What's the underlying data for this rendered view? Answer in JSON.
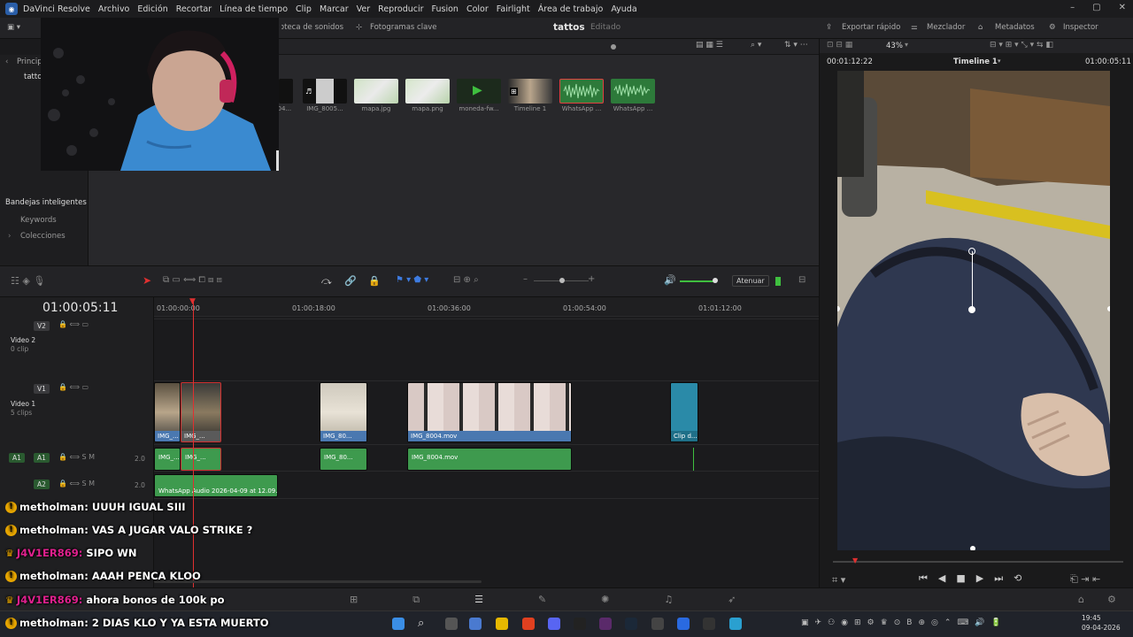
{
  "app": {
    "title": "DaVinci Resolve"
  },
  "menu": [
    "Archivo",
    "Edición",
    "Recortar",
    "Línea de tiempo",
    "Clip",
    "Marcar",
    "Ver",
    "Reproducir",
    "Fusion",
    "Color",
    "Fairlight",
    "Área de trabajo",
    "Ayuda"
  ],
  "toolbar": {
    "sound_library": "Biblioteca de sonidos",
    "keyframes": "Fotogramas clave",
    "project_name": "tattos",
    "project_state": "Editado",
    "quick_export": "Exportar rápido",
    "mixer": "Mezclador",
    "metadata": "Metadatos",
    "inspector": "Inspector"
  },
  "left_panel": {
    "master": "Principal",
    "bin": "tattos",
    "smart_bins": "Bandejas inteligentes",
    "keywords": "Keywords",
    "collections": "Colecciones"
  },
  "media_pool": {
    "items": [
      {
        "label": "...04...",
        "kind": "video"
      },
      {
        "label": "IMG_8005...",
        "kind": "video"
      },
      {
        "label": "mapa.jpg",
        "kind": "image"
      },
      {
        "label": "mapa.png",
        "kind": "image"
      },
      {
        "label": "moneda-fw...",
        "kind": "video"
      },
      {
        "label": "Timeline 1",
        "kind": "timeline"
      },
      {
        "label": "WhatsApp ...",
        "kind": "audio"
      },
      {
        "label": "WhatsApp ...",
        "kind": "audio"
      }
    ]
  },
  "viewer": {
    "zoom": "43%",
    "timecode_left": "00:01:12:22",
    "timeline_name": "Timeline 1",
    "timecode_right": "01:00:05:11"
  },
  "timeline": {
    "current_timecode": "01:00:05:11",
    "ruler": [
      "01:00:00:00",
      "01:00:18:00",
      "01:00:36:00",
      "01:00:54:00",
      "01:01:12:00"
    ],
    "attenuate": "Atenuar",
    "tracks": [
      {
        "id": "V2",
        "name": "Video 2",
        "info": "0 clip"
      },
      {
        "id": "V1",
        "name": "Video 1",
        "info": "5 clips"
      },
      {
        "id": "A1",
        "name": "A1",
        "level": "2.0"
      },
      {
        "id": "A2",
        "name": "A2",
        "level": "2.0"
      }
    ],
    "video_clips": [
      "IMG_...",
      "IMG_...",
      "IMG_80...",
      "IMG_8004.mov",
      "Clip d..."
    ],
    "audio_clips": [
      "IMG_...",
      "IMG_...",
      "IMG_80...",
      "IMG_8004.mov",
      "WhatsApp Audio 2026-04-09 at 12.09..."
    ]
  },
  "chat": [
    {
      "user": "metholman:",
      "msg": "UUUH IGUAL SIII",
      "badge": "sub"
    },
    {
      "user": "metholman:",
      "msg": "VAS A JUGAR VALO STRIKE ?",
      "badge": "sub"
    },
    {
      "user": "J4V1ER869:",
      "msg": "SIPO WN",
      "badge": "crown"
    },
    {
      "user": "metholman:",
      "msg": "AAAH PENCA KLOO",
      "badge": "sub"
    },
    {
      "user": "J4V1ER869:",
      "msg": "ahora bonos de 100k po",
      "badge": "crown"
    },
    {
      "user": "metholman:",
      "msg": "2 DIAS KLO Y YA ESTA MUERTO",
      "badge": "sub"
    }
  ],
  "taskbar": {
    "time": "19:45",
    "date": "09-04-2026"
  },
  "colors": {
    "accent": "#e0208e",
    "video_clip": "#4a78b0",
    "audio_clip": "#3e9a4e",
    "playhead": "#e03030"
  }
}
